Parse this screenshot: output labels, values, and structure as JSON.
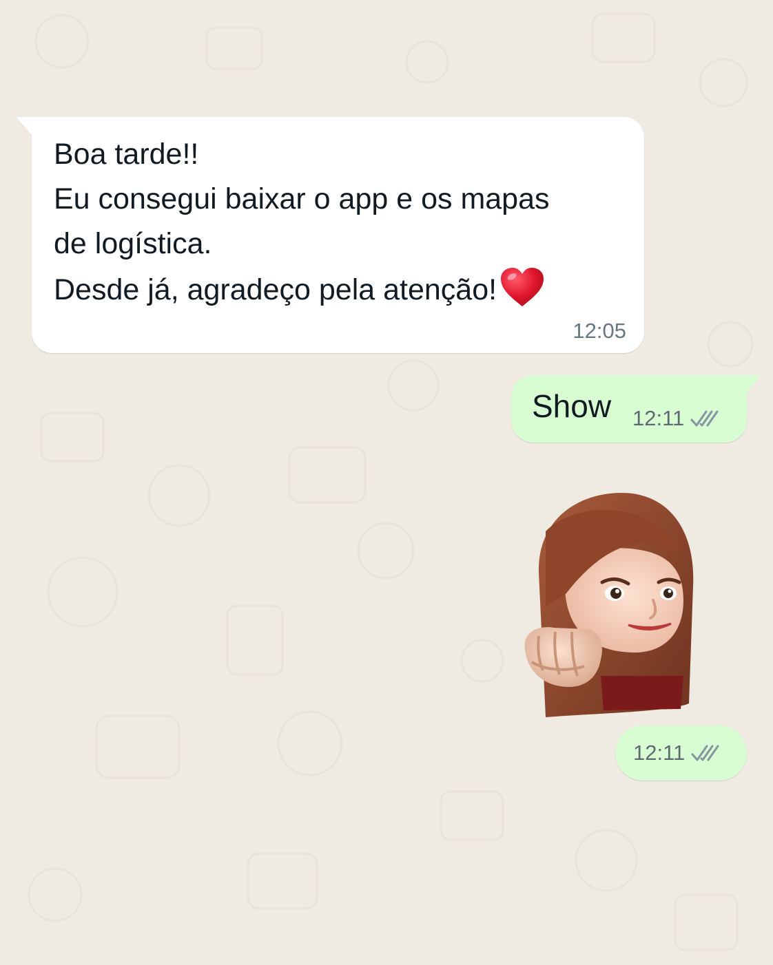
{
  "chat": {
    "incoming": {
      "lines": [
        "Boa tarde!!",
        "Eu consegui baixar o app e os mapas",
        "de logística.",
        "Desde já, agradeço pela atenção!"
      ],
      "emoji": "heart-emoji",
      "time": "12:05"
    },
    "outgoing_text": {
      "text": "Show",
      "time": "12:11",
      "status_icon": "double-check-icon"
    },
    "outgoing_sticker": {
      "sticker": "memoji-fist-bump-sticker",
      "time": "12:11",
      "status_icon": "double-check-icon"
    }
  },
  "colors": {
    "background": "#efeae2",
    "incoming_bubble": "#ffffff",
    "outgoing_bubble": "#d9fdd3",
    "text": "#111b21",
    "timestamp": "#667781",
    "heart": "#e0162b"
  }
}
